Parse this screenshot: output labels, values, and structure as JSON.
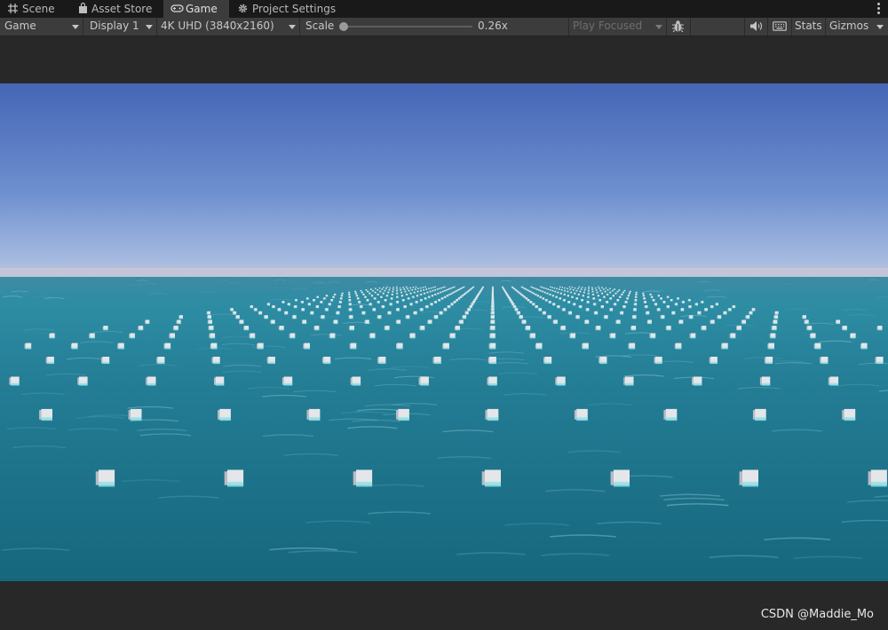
{
  "tabs": [
    {
      "label": "Scene",
      "icon": "grid-icon",
      "active": false
    },
    {
      "label": "Asset Store",
      "icon": "bag-icon",
      "active": false
    },
    {
      "label": "Game",
      "icon": "gamepad-icon",
      "active": true
    },
    {
      "label": "Project Settings",
      "icon": "gear-icon",
      "active": false
    }
  ],
  "toolbar": {
    "mode": "Game",
    "display": "Display 1",
    "resolution": "4K UHD (3840x2160)",
    "scale_label": "Scale",
    "scale_value": "0.26x",
    "scale_fraction": 0.02,
    "play_mode": "Play Focused",
    "stats_label": "Stats",
    "gizmos_label": "Gizmos",
    "icons": [
      "bug-icon",
      "speaker-icon",
      "keyboard-icon"
    ]
  },
  "watermark": "CSDN @Maddie_Mo",
  "colors": {
    "sky_top": "#4466b5",
    "sky_horizon": "#a8bde0",
    "ocean": "#1d6f86",
    "ocean_near": "#156a80",
    "cube": "#e4e6ea"
  }
}
